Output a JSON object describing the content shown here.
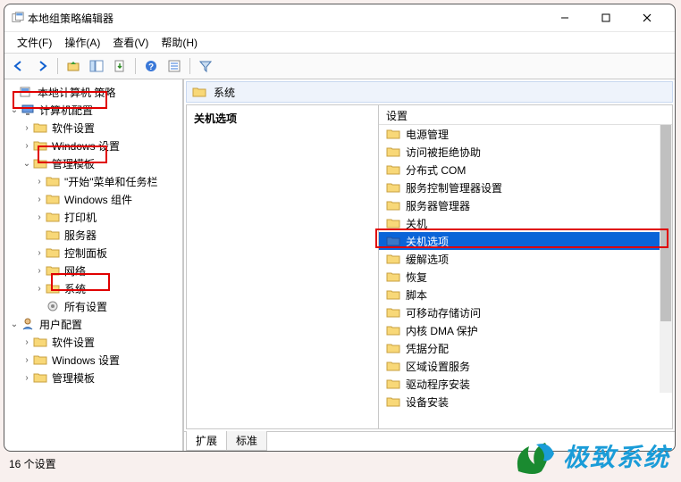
{
  "window": {
    "title": "本地组策略编辑器"
  },
  "menu": {
    "file": "文件(F)",
    "action": "操作(A)",
    "view": "查看(V)",
    "help": "帮助(H)"
  },
  "tree": {
    "root": "本地计算机 策略",
    "n1": "计算机配置",
    "n1a": "软件设置",
    "n1b": "Windows 设置",
    "n1c": "管理模板",
    "n1c1": "\"开始\"菜单和任务栏",
    "n1c2": "Windows 组件",
    "n1c3": "打印机",
    "n1c4": "服务器",
    "n1c5": "控制面板",
    "n1c6": "网络",
    "n1c7": "系统",
    "n1c8": "所有设置",
    "n2": "用户配置",
    "n2a": "软件设置",
    "n2b": "Windows 设置",
    "n2c": "管理模板"
  },
  "crumb": {
    "label": "系统"
  },
  "left_panel": {
    "title": "关机选项"
  },
  "list": {
    "header": "设置",
    "items": [
      "电源管理",
      "访问被拒绝协助",
      "分布式 COM",
      "服务控制管理器设置",
      "服务器管理器",
      "关机",
      "关机选项",
      "缓解选项",
      "恢复",
      "脚本",
      "可移动存储访问",
      "内核 DMA 保护",
      "凭据分配",
      "区域设置服务",
      "驱动程序安装",
      "设备安装"
    ],
    "selected_index": 6
  },
  "tabs": {
    "t1": "扩展",
    "t2": "标准"
  },
  "status": {
    "text": "16 个设置"
  },
  "watermark": {
    "text": "极致系统"
  }
}
